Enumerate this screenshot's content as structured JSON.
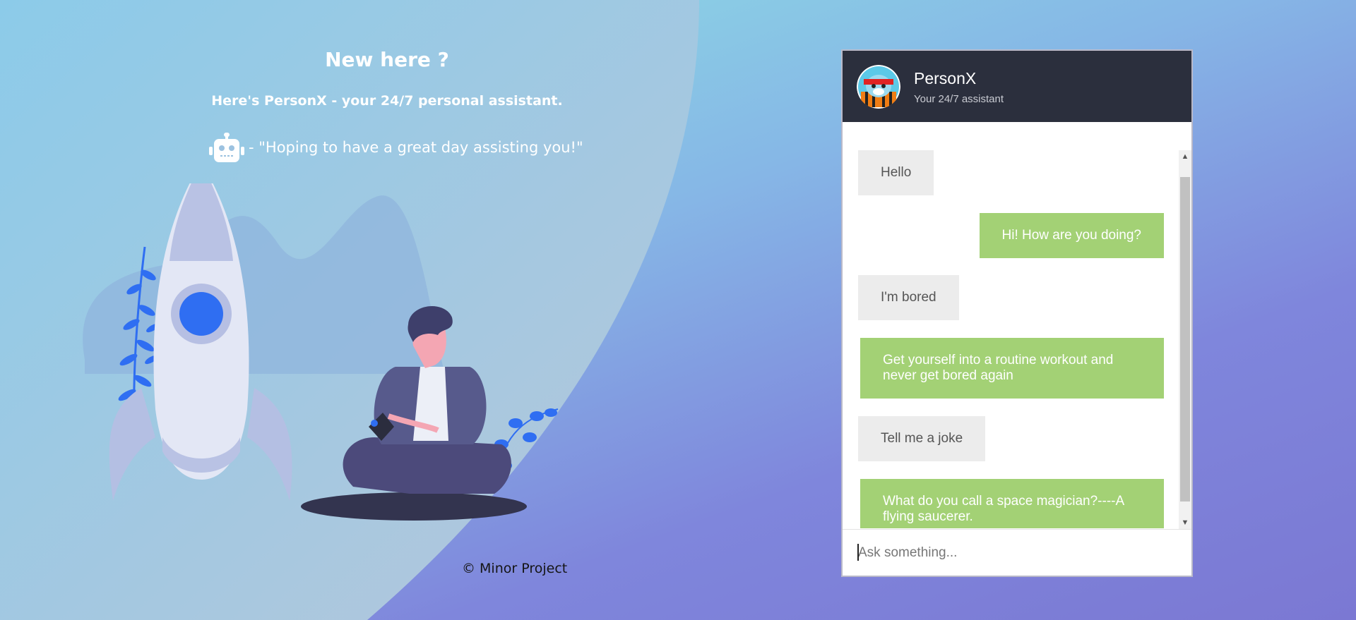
{
  "hero": {
    "title": "New here ?",
    "tagline": "Here's PersonX - your 24/7 personal assistant.",
    "quote": "- \"Hoping to have a great day assisting you!\""
  },
  "footer": {
    "text": "© Minor Project"
  },
  "chat": {
    "bot_name": "PersonX",
    "bot_subtitle": "Your 24/7 assistant",
    "messages": [
      {
        "from": "user",
        "text": "Hello"
      },
      {
        "from": "bot",
        "text": "Hi! How are you doing?"
      },
      {
        "from": "user",
        "text": "I'm bored"
      },
      {
        "from": "bot",
        "text": "Get yourself into a routine workout and never get bored again"
      },
      {
        "from": "user",
        "text": "Tell me a joke"
      },
      {
        "from": "bot",
        "text": "What do you call a space magician?----A flying saucerer."
      }
    ],
    "input_placeholder": "Ask something..."
  },
  "colors": {
    "header_bg": "#2b2f3d",
    "bot_bubble": "#a3d175",
    "user_bubble": "#ececec",
    "bg_top": "#8fe7e3",
    "bg_bottom": "#7b78d3"
  },
  "icons": [
    "robot-icon",
    "bot-avatar-icon",
    "rocket-illustration",
    "person-illustration",
    "scroll-up-icon",
    "scroll-down-icon"
  ]
}
